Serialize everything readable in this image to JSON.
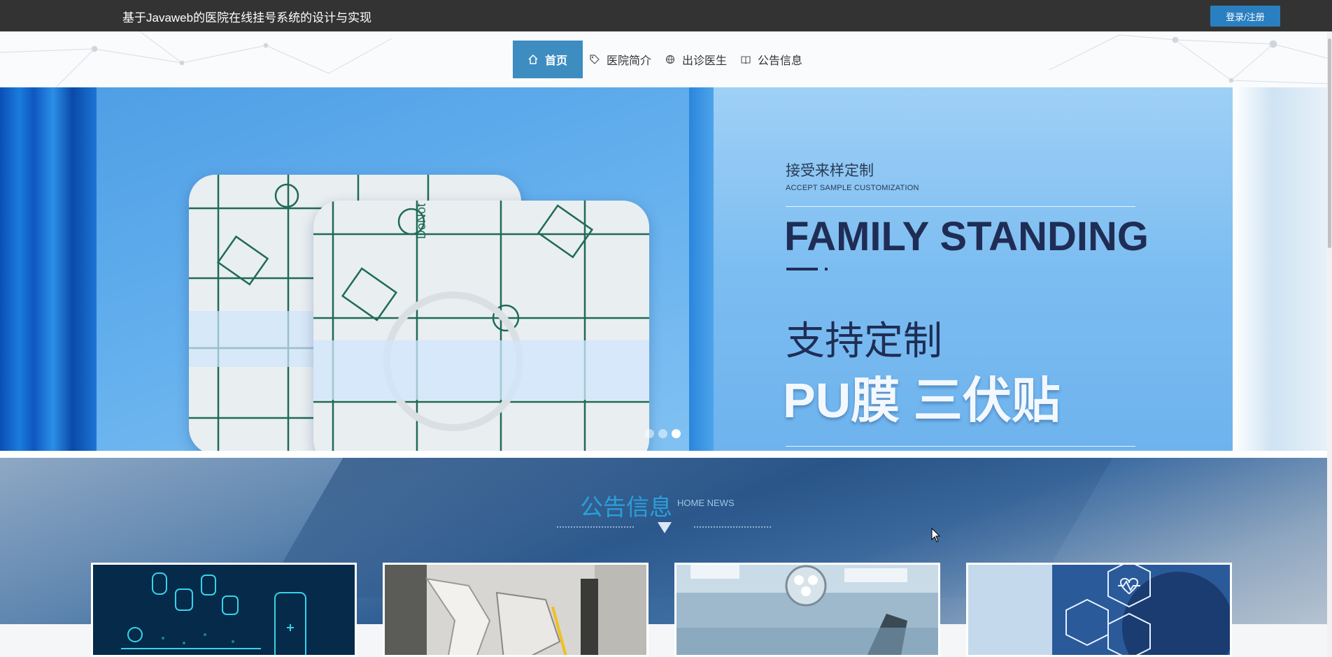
{
  "header": {
    "site_title": "基于Javaweb的医院在线挂号系统的设计与实现",
    "login_label": "登录/注册"
  },
  "nav": {
    "items": [
      {
        "label": "首页",
        "icon": "home-icon",
        "active": true
      },
      {
        "label": "医院简介",
        "icon": "tag-icon",
        "active": false
      },
      {
        "label": "出诊医生",
        "icon": "globe-icon",
        "active": false
      },
      {
        "label": "公告信息",
        "icon": "book-icon",
        "active": false
      }
    ]
  },
  "banner": {
    "accept_cn": "接受来样定制",
    "accept_en": "ACCEPT SAMPLE CUSTOMIZATION",
    "family": "FAMILY STANDING",
    "support": "支持定制",
    "product": "PU膜 三伏贴",
    "patch_text": "DoNot Reuse",
    "slides_count": 3,
    "active_slide": 3
  },
  "news": {
    "title": "公告信息",
    "subtitle": "HOME NEWS",
    "cards": [
      {
        "image": "medical-tech-icons-image"
      },
      {
        "image": "surgical-robot-image"
      },
      {
        "image": "operating-room-image"
      },
      {
        "image": "health-heart-icons-image"
      }
    ]
  },
  "colors": {
    "topbar": "#333333",
    "accent": "#3d8dc1",
    "login_button": "#2a7fc0",
    "news_title": "#2a9fd8"
  }
}
